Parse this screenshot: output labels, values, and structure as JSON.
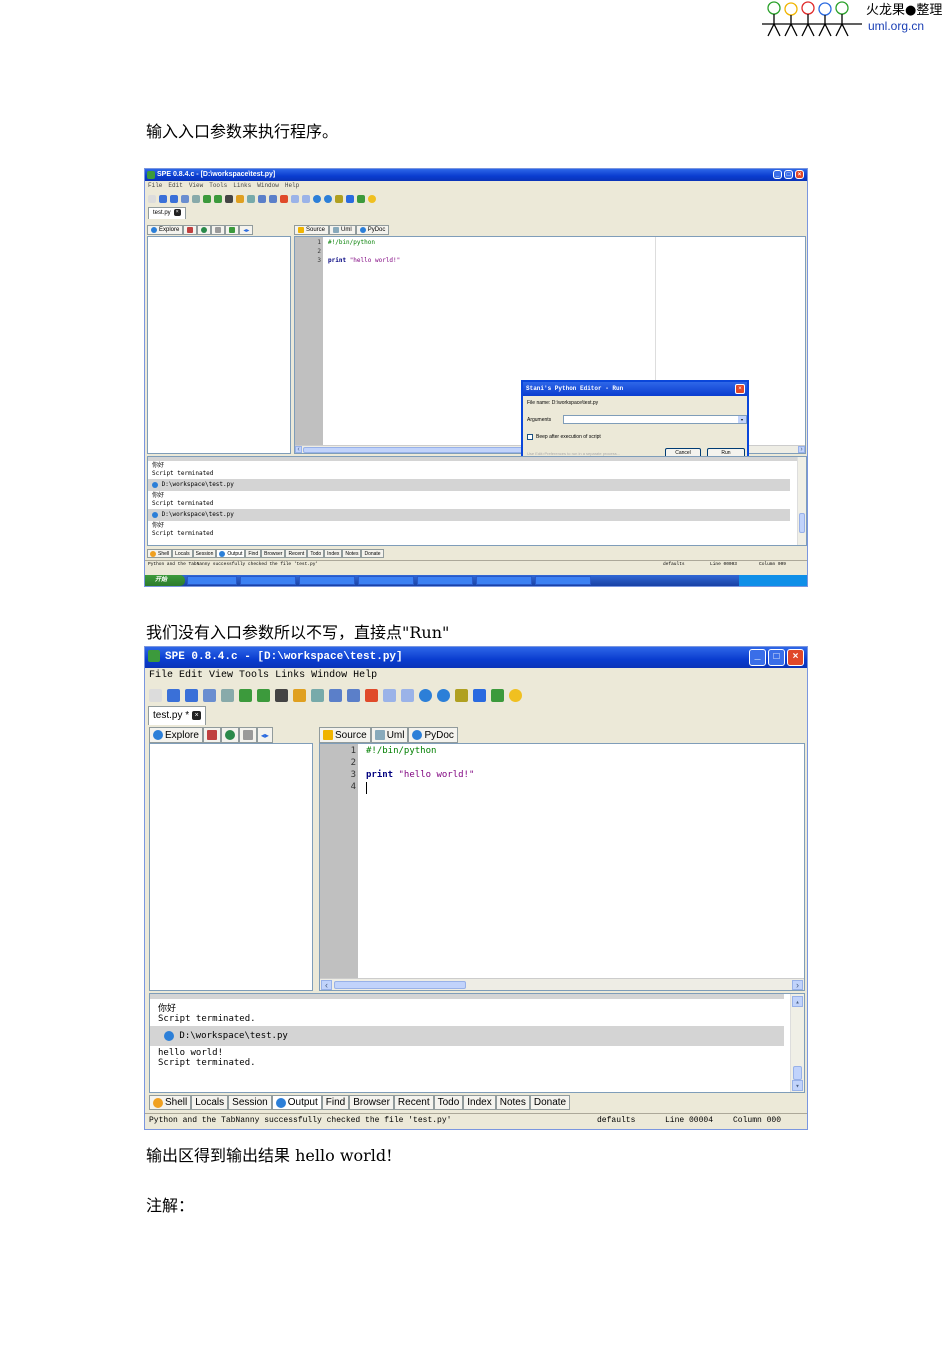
{
  "logo": {
    "title": "火龙果●整理",
    "url": "uml.org.cn"
  },
  "paragraphs": {
    "p1": "输入入口参数来执行程序。",
    "p2": "我们没有入口参数所以不写，直接点\"Run\"",
    "p3": "输出区得到输出结果 hello world!",
    "p4": "注解："
  },
  "window": {
    "title": "SPE 0.8.4.c - [D:\\workspace\\test.py]",
    "menu": [
      "File",
      "Edit",
      "View",
      "Tools",
      "Links",
      "Window",
      "Help"
    ],
    "file_tab": "test.py *",
    "side_tabs": [
      "Explore"
    ],
    "editor_tabs": [
      "Source",
      "Uml",
      "PyDoc"
    ],
    "code": {
      "line_numbers": [
        "1",
        "2",
        "3",
        "4"
      ],
      "shebang": "#!/bin/python",
      "print_kw": "print",
      "print_str": "\"hello world!\""
    },
    "bottom_tabs": [
      "Shell",
      "Locals",
      "Session",
      "Output",
      "Find",
      "Browser",
      "Recent",
      "Todo",
      "Index",
      "Notes",
      "Donate"
    ]
  },
  "shot1": {
    "title": "SPE 0.8.4.c - [D:\\workspace\\test.py]",
    "file_tab": "test.py",
    "output_lines": [
      "你好",
      "Script terminated",
      "D:\\workspace\\test.py",
      "你好",
      "Script terminated",
      "D:\\workspace\\test.py",
      "你好",
      "Script terminated"
    ],
    "status_left": "Python and the TabNanny successfully checked the file 'test.py'",
    "status_defaults": "defaults",
    "status_line": "Line 00003",
    "status_col": "Column 009",
    "start_label": "开始",
    "dialog": {
      "title": "Stani's Python Editor - Run",
      "file_name": "File name: D:\\workspace\\test.py",
      "arguments_label": "Arguments",
      "beep_label": "Beep after execution of script",
      "hint": "Use Edit>Preferences to run in a separate process...",
      "cancel": "Cancel",
      "run": "Run"
    }
  },
  "shot2": {
    "output_top": "你好",
    "output_terminated": "Script terminated.",
    "output_path": "D:\\workspace\\test.py",
    "output_hello": "hello world!",
    "output_terminated2": "Script terminated.",
    "status_left": "Python and the TabNanny successfully checked the file 'test.py'",
    "status_defaults": "defaults",
    "status_line": "Line 00004",
    "status_col": "Column 000"
  },
  "colors": {
    "accent": "#0a3ccf",
    "xp_bg": "#ece9d8"
  }
}
